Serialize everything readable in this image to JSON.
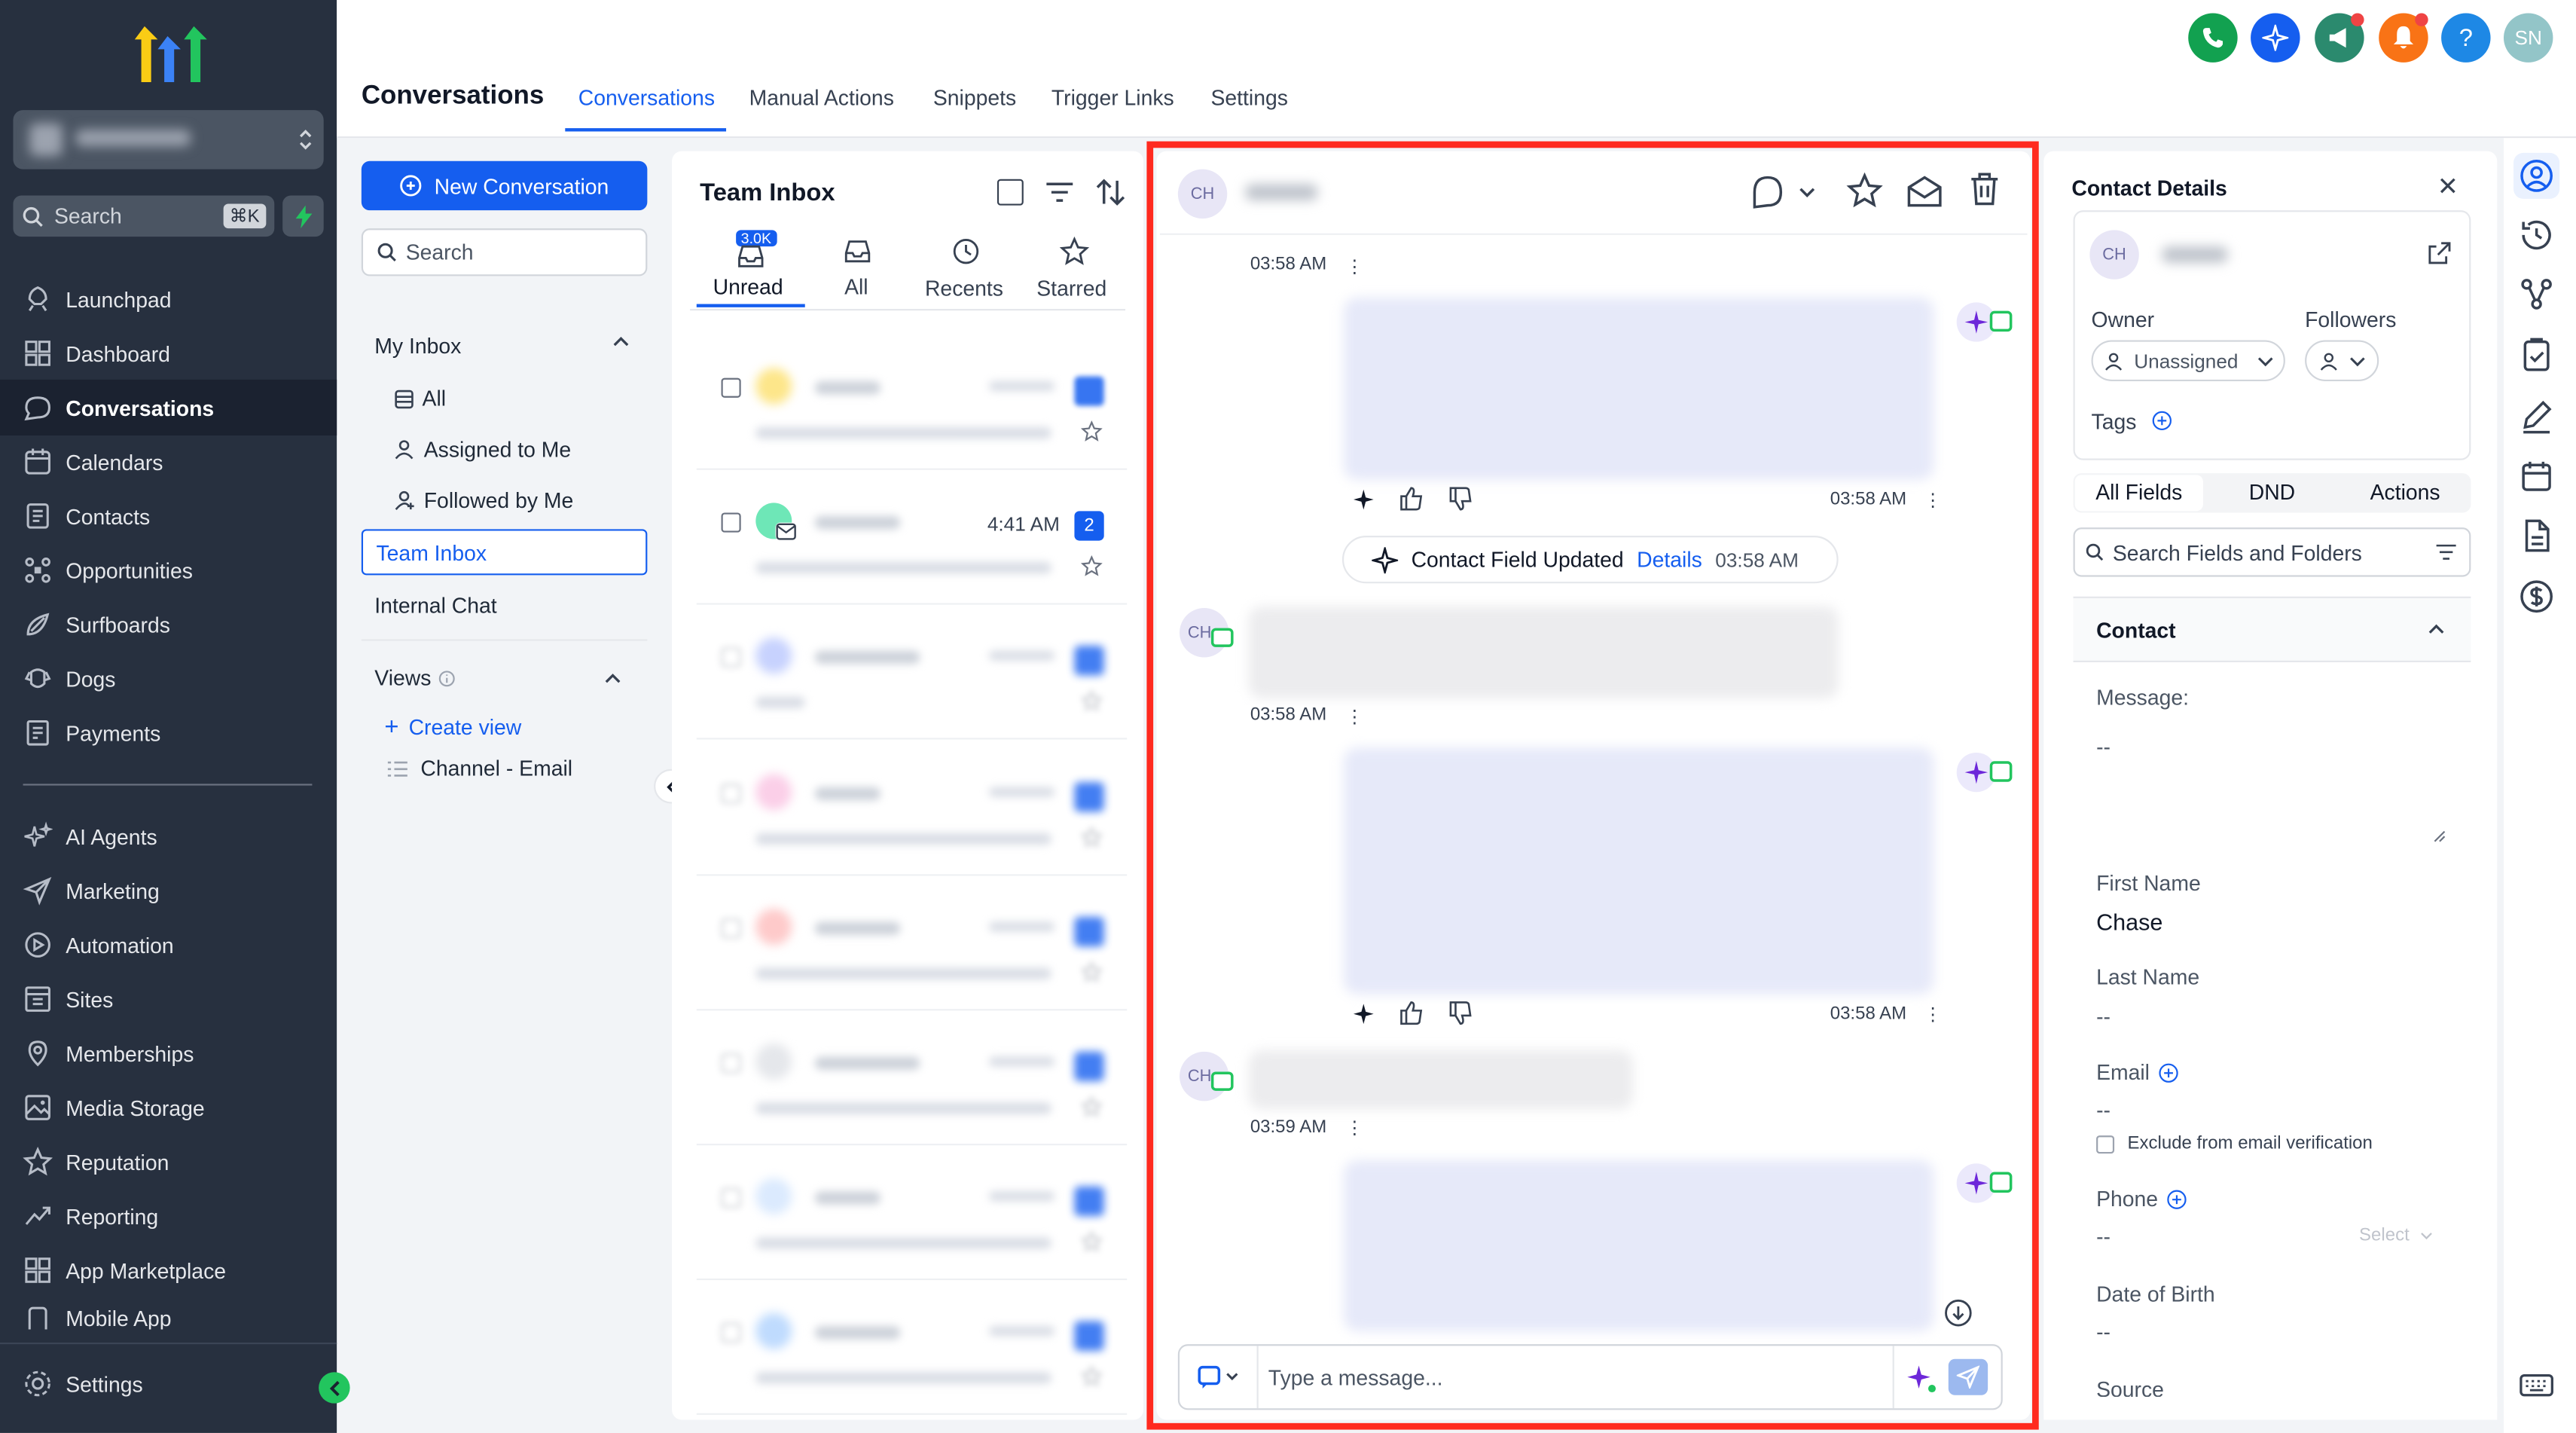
{
  "sidebar": {
    "account_name": "",
    "search_placeholder": "Search",
    "search_shortcut": "⌘K",
    "items": [
      {
        "label": "Launchpad",
        "icon": "rocket-icon"
      },
      {
        "label": "Dashboard",
        "icon": "dashboard-icon"
      },
      {
        "label": "Conversations",
        "icon": "chat-icon"
      },
      {
        "label": "Calendars",
        "icon": "calendar-icon"
      },
      {
        "label": "Contacts",
        "icon": "contacts-icon"
      },
      {
        "label": "Opportunities",
        "icon": "opportunities-icon"
      },
      {
        "label": "Surfboards",
        "icon": "surfboard-icon"
      },
      {
        "label": "Dogs",
        "icon": "dog-icon"
      },
      {
        "label": "Payments",
        "icon": "payments-icon"
      }
    ],
    "items2": [
      {
        "label": "AI Agents",
        "icon": "sparkle-icon"
      },
      {
        "label": "Marketing",
        "icon": "send-icon"
      },
      {
        "label": "Automation",
        "icon": "automation-icon"
      },
      {
        "label": "Sites",
        "icon": "sites-icon"
      },
      {
        "label": "Memberships",
        "icon": "memberships-icon"
      },
      {
        "label": "Media Storage",
        "icon": "media-icon"
      },
      {
        "label": "Reputation",
        "icon": "star-icon"
      },
      {
        "label": "Reporting",
        "icon": "reporting-icon"
      },
      {
        "label": "App Marketplace",
        "icon": "apps-icon"
      },
      {
        "label": "Mobile App",
        "icon": "mobile-icon"
      }
    ],
    "settings_label": "Settings"
  },
  "header": {
    "title": "Conversations",
    "tabs": [
      "Conversations",
      "Manual Actions",
      "Snippets",
      "Trigger Links",
      "Settings"
    ],
    "avatar_initials": "SN",
    "help": "?"
  },
  "inbox_nav": {
    "new_conversation": "New Conversation",
    "search_placeholder": "Search",
    "my_inbox": "My Inbox",
    "all": "All",
    "assigned": "Assigned to Me",
    "followed": "Followed by Me",
    "team_inbox": "Team Inbox",
    "internal_chat": "Internal Chat",
    "views": "Views",
    "create_view": "Create view",
    "channel_email": "Channel - Email"
  },
  "list": {
    "title": "Team Inbox",
    "badge": "3.0K",
    "tabs": [
      "Unread",
      "All",
      "Recents",
      "Starred"
    ],
    "row2_time": "4:41 AM",
    "row2_count": "2"
  },
  "chat": {
    "avatar": "CH",
    "t1": "03:58 AM",
    "t2": "03:58 AM",
    "field_updated": "Contact Field Updated",
    "details": "Details",
    "t3": "03:58 AM",
    "t4": "03:58 AM",
    "t5": "03:58 AM",
    "t6": "03:59 AM",
    "input_placeholder": "Type a message..."
  },
  "contact": {
    "header": "Contact Details",
    "avatar": "CH",
    "owner_label": "Owner",
    "owner_value": "Unassigned",
    "followers_label": "Followers",
    "tags_label": "Tags",
    "tabs": [
      "All Fields",
      "DND",
      "Actions"
    ],
    "search_placeholder": "Search Fields and Folders",
    "section": "Contact",
    "message_label": "Message:",
    "message_value": "--",
    "first_name_label": "First Name",
    "first_name_value": "Chase",
    "last_name_label": "Last Name",
    "last_name_value": "--",
    "email_label": "Email",
    "email_value": "--",
    "exclude_email": "Exclude from email verification",
    "phone_label": "Phone",
    "phone_value": "--",
    "phone_select": "Select",
    "dob_label": "Date of Birth",
    "dob_value": "--",
    "source_label": "Source"
  },
  "colors": {
    "sidebar_bg": "#27303f",
    "accent": "#155eef",
    "highlight": "#ff2a1f",
    "phone_green": "#12a150",
    "megaphone_green": "#2b8a6e",
    "bell_orange": "#f97316"
  }
}
